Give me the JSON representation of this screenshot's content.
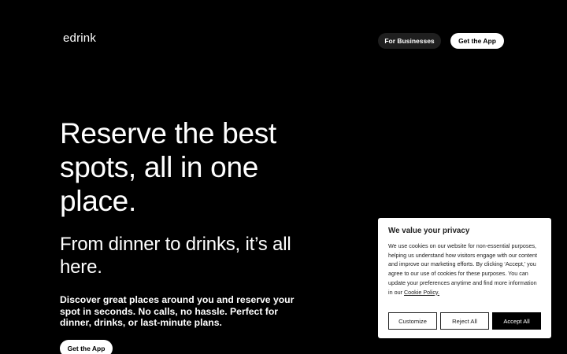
{
  "header": {
    "logo": "edrink",
    "for_businesses": "For Businesses",
    "get_app": "Get the App"
  },
  "hero": {
    "title": "Reserve the best spots, all in one place.",
    "subtitle": "From dinner to drinks, it’s all here.",
    "description": "Discover great places around you and reserve your spot in seconds. No calls, no hassle. Perfect for dinner, drinks, or last-minute plans.",
    "cta": "Get the App"
  },
  "cookie_banner": {
    "title": "We value your privacy",
    "text": "We use cookies on our website for non-essential purposes, helping us understand how visitors engage with our content and improve our marketing efforts. By clicking ‘Accept,’ you agree to our use of cookies for these purposes. You can update your preferences anytime and find more information in our",
    "link": "Cookie Policy.",
    "customize": "Customize",
    "reject": "Reject All",
    "accept": "Accept All"
  }
}
